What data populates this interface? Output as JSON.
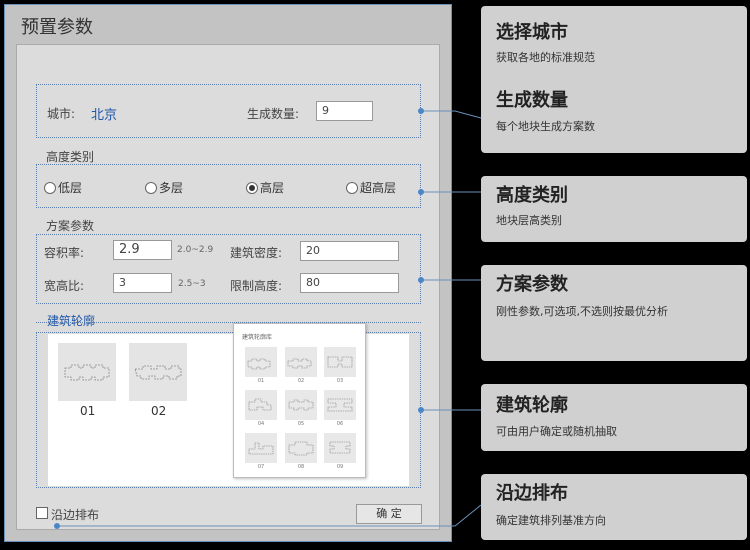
{
  "dialog": {
    "title": "预置参数",
    "city_label": "城市:",
    "city_value": "北京",
    "count_label": "生成数量:",
    "count_value": "9",
    "height_section": "高度类别",
    "height_options": [
      "低层",
      "多层",
      "高层",
      "超高层"
    ],
    "height_selected": "高层",
    "scheme_section": "方案参数",
    "far_label": "容积率:",
    "far_value": "2.9",
    "far_hint": "2.0~2.9",
    "density_label": "建筑密度:",
    "density_value": "20",
    "ratio_label": "宽高比:",
    "ratio_value": "3",
    "ratio_hint": "2.5~3",
    "height_limit_label": "限制高度:",
    "height_limit_value": "80",
    "outline_section": "建筑轮廓",
    "thumbs": [
      "01",
      "02"
    ],
    "popup_title": "建筑轮廓库",
    "popup_labels": [
      "01",
      "02",
      "03",
      "04",
      "05",
      "06",
      "07",
      "08",
      "09"
    ],
    "edge_label": "沿边排布",
    "confirm": "确 定"
  },
  "cards": [
    {
      "title": "选择城市",
      "desc": "获取各地的标准规范"
    },
    {
      "title": "生成数量",
      "desc": "每个地块生成方案数"
    },
    {
      "title": "高度类别",
      "desc": "地块层高类别"
    },
    {
      "title": "方案参数",
      "desc": "刚性参数,可选项,不选则按最优分析"
    },
    {
      "title": "建筑轮廓",
      "desc": "可由用户确定或随机抽取"
    },
    {
      "title": "沿边排布",
      "desc": "确定建筑排列基准方向"
    }
  ],
  "colors": {
    "accent": "#1f56a8",
    "connector": "#6a8fb8",
    "card_bg": "#d0d0d0"
  }
}
